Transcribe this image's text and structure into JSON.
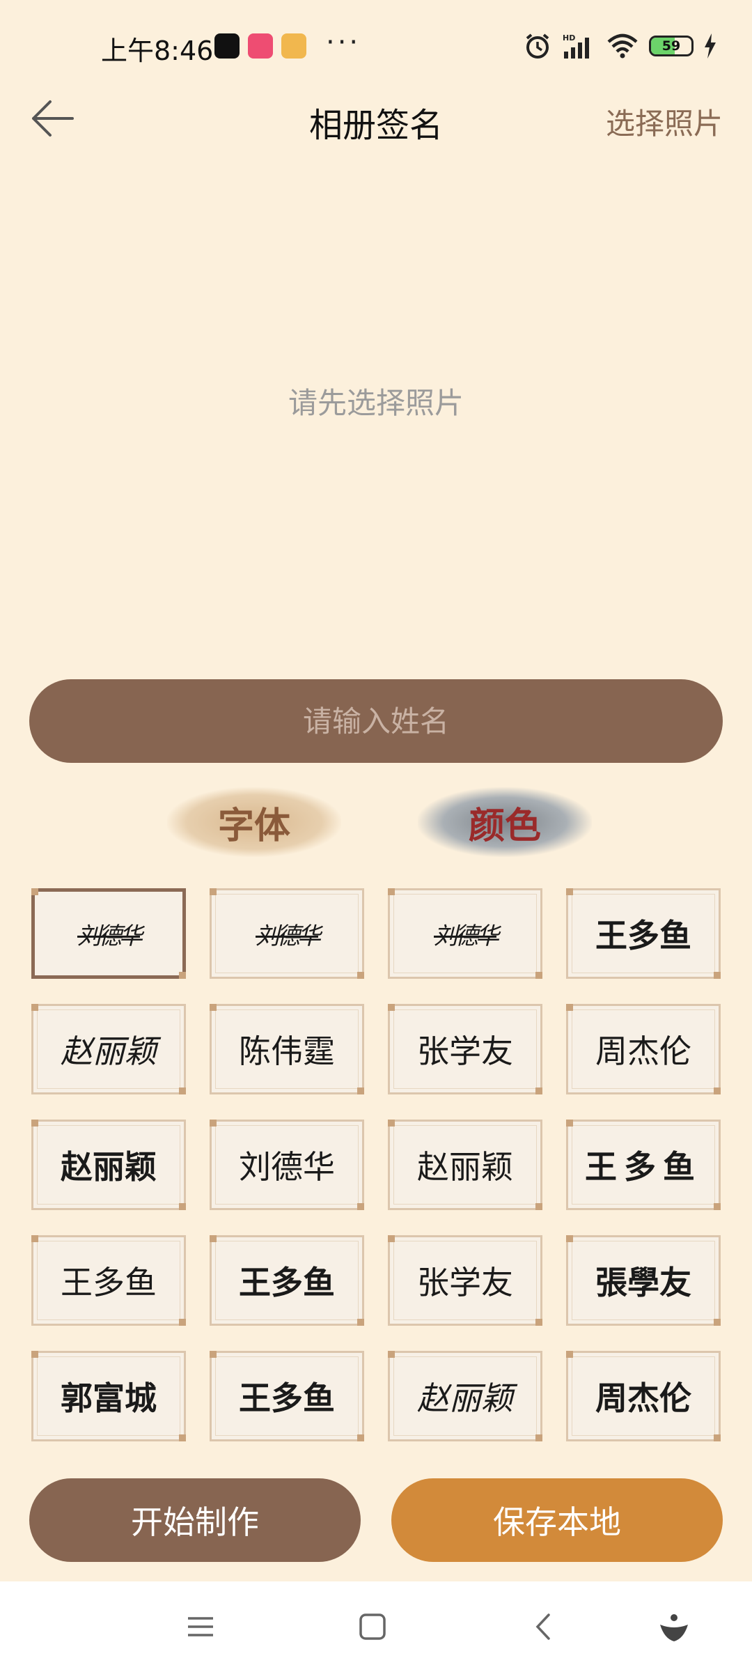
{
  "status_bar": {
    "time": "上午8:46",
    "dots": "···",
    "battery": 59,
    "battery_label": "59",
    "icons": [
      "tiktok-icon",
      "download-app-icon",
      "smile-app-icon",
      "alarm-icon",
      "signal-hd-icon",
      "wifi-icon",
      "battery-icon",
      "charging-icon"
    ]
  },
  "header": {
    "title": "相册签名",
    "action": "选择照片"
  },
  "preview": {
    "empty_text": "请先选择照片"
  },
  "name_input": {
    "placeholder": "请输入姓名",
    "value": ""
  },
  "tabs": [
    {
      "label": "字体"
    },
    {
      "label": "颜色"
    }
  ],
  "fonts": [
    {
      "label": "刘德华",
      "style": "script",
      "selected": true
    },
    {
      "label": "刘德华",
      "style": "script"
    },
    {
      "label": "刘德华",
      "style": "script"
    },
    {
      "label": "王多鱼",
      "style": "bold"
    },
    {
      "label": "赵丽颖",
      "style": "italic"
    },
    {
      "label": "陈伟霆",
      "style": "serif"
    },
    {
      "label": "张学友",
      "style": "serif"
    },
    {
      "label": "周杰伦",
      "style": "serif"
    },
    {
      "label": "赵丽颖",
      "style": "bold"
    },
    {
      "label": "刘德华",
      "style": "plain"
    },
    {
      "label": "赵丽颖",
      "style": "serif"
    },
    {
      "label": "王多鱼",
      "style": "wide"
    },
    {
      "label": "王多鱼",
      "style": "plain"
    },
    {
      "label": "王多鱼",
      "style": "bold"
    },
    {
      "label": "张学友",
      "style": "plain"
    },
    {
      "label": "張學友",
      "style": "bold"
    },
    {
      "label": "郭富城",
      "style": "bold"
    },
    {
      "label": "王多鱼",
      "style": "bold"
    },
    {
      "label": "赵丽颖",
      "style": "italic"
    },
    {
      "label": "周杰伦",
      "style": "bold"
    }
  ],
  "buttons": {
    "start": "开始制作",
    "save": "保存本地"
  },
  "colors": {
    "background": "#fcf0dc",
    "brown": "#876551",
    "orange": "#d28a3a"
  }
}
